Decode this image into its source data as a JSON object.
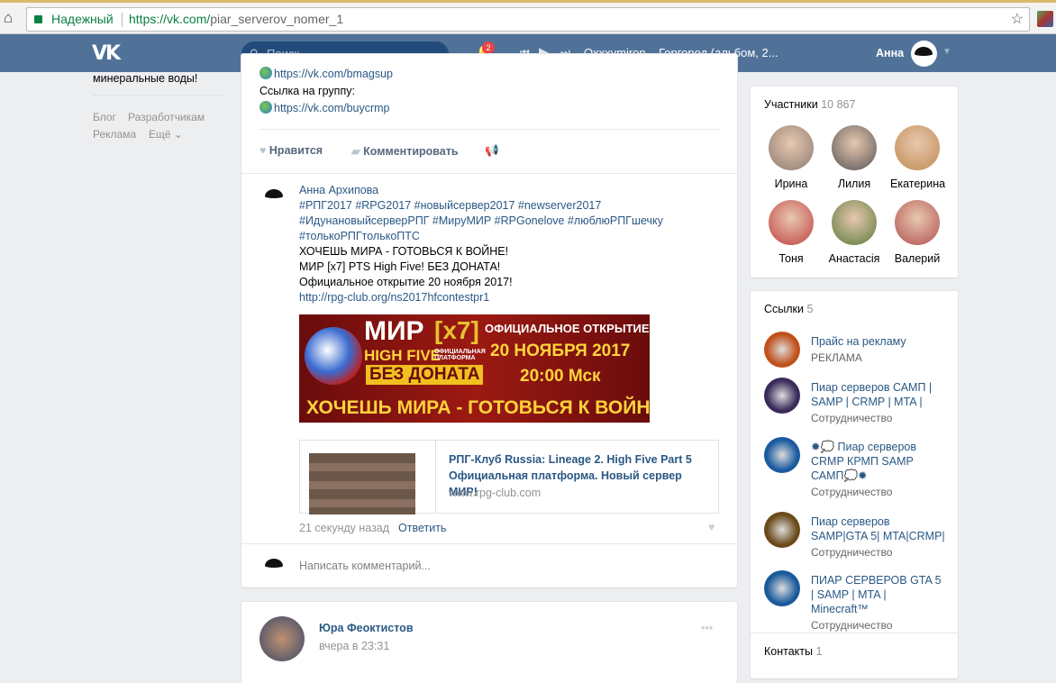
{
  "browser": {
    "secure_label": "Надежный",
    "url_host": "https://vk.com/",
    "url_path": "piar_serverov_nomer_1",
    "star_icon": "☆"
  },
  "header": {
    "logo": "VK",
    "search_placeholder": "Поиск",
    "notifications_count": "2",
    "track": "Oxxxymiron – Горгород (альбом, 2...",
    "user_name": "Анна",
    "brand_color": "#507299"
  },
  "left": {
    "text": "минеральные воды!",
    "links": [
      "Блог",
      "Разработчикам",
      "Реклама",
      "Ещё ⌄"
    ]
  },
  "post_top": {
    "link1": "https://vk.com/bmagsup",
    "group_label": "Ссылка на группу:",
    "link2": "https://vk.com/buycrmp",
    "like": "Нравится",
    "comment": "Комментировать"
  },
  "comment": {
    "author": "Анна Архипова",
    "lines": [
      "#РПГ2017 #RPG2017 #новыйсервер2017 #newserver2017",
      "#ИдунановыйсерверРПГ #МирyМИР #RPGonelove #люблюРПГшечку",
      "#толькоРПГтолькоПТС",
      "ХОЧЕШЬ МИРА - ГОТОВЬСЯ К ВОЙНЕ!",
      "МИР [x7] PTS High Five! БЕЗ ДОНАТА!",
      "Официальное открытие 20 ноября 2017!"
    ],
    "url": "http://rpg-club.org/ns2017hfcontestpr1",
    "banner": {
      "mir": "МИР",
      "x7": "[x7]",
      "high_five": "HIGH FIVE",
      "official": "ОФИЦИАЛЬНАЯ ПЛАТФОРМА",
      "no_donate": "БЕЗ ДОНАТА",
      "open": "ОФИЦИАЛЬНОЕ ОТКРЫТИЕ",
      "date": "20 НОЯБРЯ 2017",
      "time": "20:00 Мск",
      "slogan": "ХОЧЕШЬ МИРА - ГОТОВЬСЯ К ВОЙНЕ"
    },
    "link_title": "РПГ-Клуб Russia: Lineage 2. High Five Part 5 Официальная платформа. Новый сервер МИР!",
    "link_domain": "www.rpg-club.com",
    "time": "21 секунду назад",
    "reply": "Ответить"
  },
  "write_comment_placeholder": "Написать комментарий...",
  "next_post": {
    "author": "Юра Феоктистов",
    "time": "вчера в 23:31",
    "more": "•••"
  },
  "members": {
    "title": "Участники",
    "count": "10 867",
    "people": [
      {
        "name": "Ирина",
        "color": "#8a7a70"
      },
      {
        "name": "Лилия",
        "color": "#555"
      },
      {
        "name": "Екатерина",
        "color": "#c08a50"
      },
      {
        "name": "Тоня",
        "color": "#c04040"
      },
      {
        "name": "Анастасія",
        "color": "#5a7a3a"
      },
      {
        "name": "Валерий",
        "color": "#b05050"
      }
    ]
  },
  "links": {
    "title": "Ссылки",
    "count": "5",
    "items": [
      {
        "title": "Прайс на рекламу",
        "sub": "РЕКЛАМА",
        "color": "#c0501a"
      },
      {
        "title": "Пиар серверов САМП | SAMP | CRMP | MTA |",
        "sub": "Сотрудничество",
        "color": "#3a2a5a"
      },
      {
        "title": "✹💭 Пиар серверов CRMP КРМП SAMP САМП💭✹",
        "sub": "Сотрудничество",
        "color": "#1a5aa0"
      },
      {
        "title": "Пиар серверов SAMP|GTA 5| MTA|CRMP|",
        "sub": "Сотрудничество",
        "color": "#6a4a1a"
      },
      {
        "title": "ПИАР СЕРВЕРОВ GTA 5 | SAMP | MTA | Minecraft™",
        "sub": "Сотрудничество",
        "color": "#1a5a9a"
      }
    ]
  },
  "contacts": {
    "title": "Контакты",
    "count": "1"
  }
}
